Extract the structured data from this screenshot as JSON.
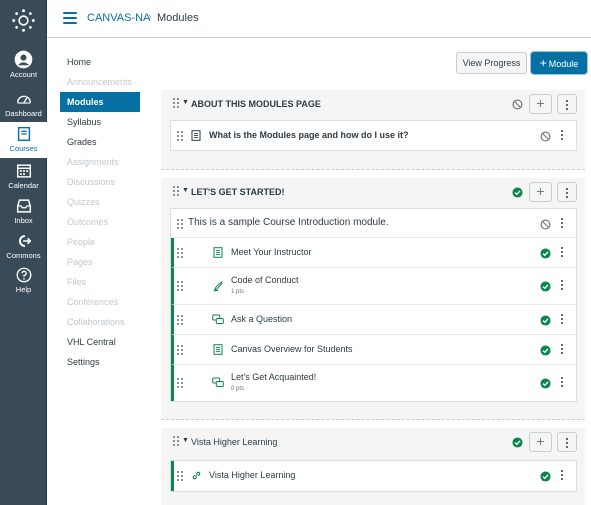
{
  "header": {
    "course": "CANVAS-NA",
    "separator": "›",
    "page": "Modules"
  },
  "global_nav": [
    {
      "label": "Account",
      "icon": "account-icon"
    },
    {
      "label": "Dashboard",
      "icon": "dashboard-icon"
    },
    {
      "label": "Courses",
      "icon": "courses-icon",
      "active": true
    },
    {
      "label": "Calendar",
      "icon": "calendar-icon"
    },
    {
      "label": "Inbox",
      "icon": "inbox-icon"
    },
    {
      "label": "Commons",
      "icon": "commons-icon"
    },
    {
      "label": "Help",
      "icon": "help-icon"
    }
  ],
  "course_nav": [
    {
      "label": "Home"
    },
    {
      "label": "Announcements",
      "disabled": true
    },
    {
      "label": "Modules",
      "active": true
    },
    {
      "label": "Syllabus"
    },
    {
      "label": "Grades"
    },
    {
      "label": "Assignments",
      "disabled": true
    },
    {
      "label": "Discussions",
      "disabled": true
    },
    {
      "label": "Quizzes",
      "disabled": true
    },
    {
      "label": "Outcomes",
      "disabled": true
    },
    {
      "label": "People",
      "disabled": true
    },
    {
      "label": "Pages",
      "disabled": true
    },
    {
      "label": "Files",
      "disabled": true
    },
    {
      "label": "Conferences",
      "disabled": true
    },
    {
      "label": "Collaborations",
      "disabled": true
    },
    {
      "label": "VHL Central"
    },
    {
      "label": "Settings"
    }
  ],
  "toolbar": {
    "view_progress": "View Progress",
    "add_module": "Module",
    "add_module_symbol": "+"
  },
  "modules": [
    {
      "title": "ABOUT THIS MODULES PAGE",
      "status": "unpublished",
      "items": [
        {
          "type": "page",
          "title": "What is the Modules page and how do I use it?",
          "status": "unpublished"
        }
      ]
    },
    {
      "title": "LET'S GET STARTED!",
      "status": "published",
      "items": [
        {
          "type": "header",
          "title": "This is a sample Course Introduction module.",
          "status": "unpublished"
        },
        {
          "type": "page",
          "title": "Meet Your Instructor",
          "status": "published"
        },
        {
          "type": "assignment",
          "title": "Code of Conduct",
          "points": "1 pts",
          "status": "published"
        },
        {
          "type": "discussion",
          "title": "Ask a Question",
          "status": "published"
        },
        {
          "type": "page",
          "title": "Canvas Overview for Students",
          "status": "published"
        },
        {
          "type": "discussion",
          "title": "Let's Get Acquainted!",
          "points": "0 pts",
          "status": "published"
        }
      ]
    },
    {
      "title": "Vista Higher Learning",
      "status": "published",
      "items": [
        {
          "type": "link",
          "title": "Vista Higher Learning",
          "status": "published"
        }
      ]
    }
  ],
  "colors": {
    "nav_bg": "#394b58",
    "link_blue": "#0770a3",
    "published_green": "#0b874b",
    "unpublished_gray": "#6b7780"
  }
}
